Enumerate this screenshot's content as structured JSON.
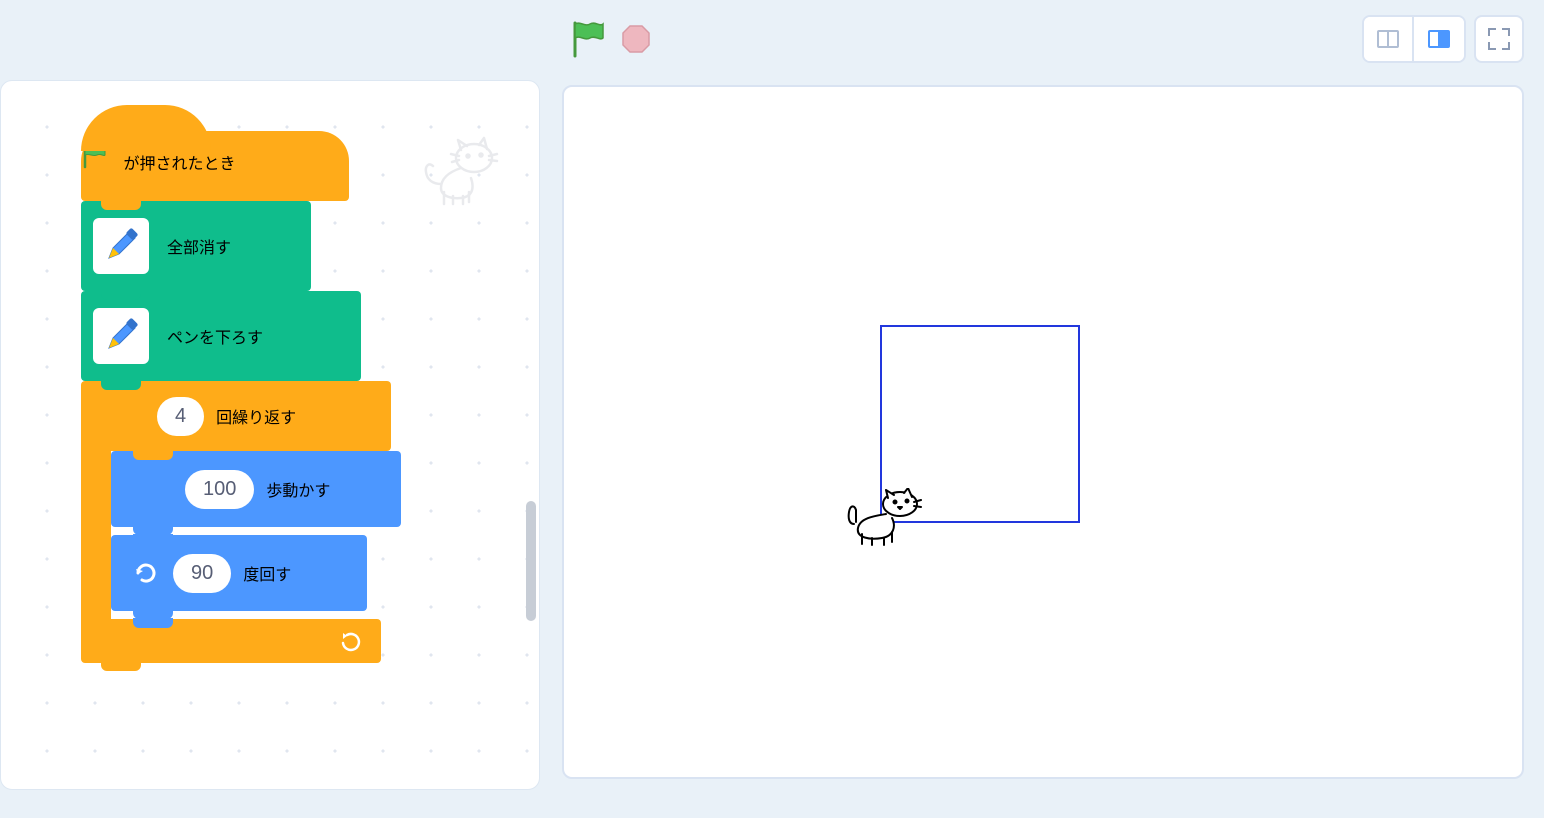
{
  "blocks": {
    "when_flag_clicked": "が押されたとき",
    "erase_all": "全部消す",
    "pen_down": "ペンを下ろす",
    "repeat_label": "回繰り返す",
    "repeat_count": "4",
    "move_label": "歩動かす",
    "move_steps": "100",
    "turn_label": "度回す",
    "turn_degrees": "90"
  }
}
